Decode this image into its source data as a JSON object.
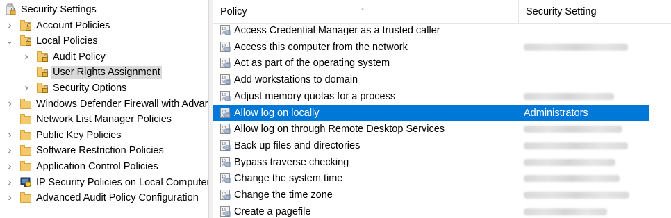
{
  "tree": {
    "items": [
      {
        "label": "Security Settings",
        "icon": "security-settings-icon",
        "expander": "",
        "indent": 0,
        "selected": false
      },
      {
        "label": "Account Policies",
        "icon": "locked-folder-icon",
        "expander": ">",
        "indent": 1,
        "selected": false
      },
      {
        "label": "Local Policies",
        "icon": "locked-folder-icon",
        "expander": "v",
        "indent": 1,
        "selected": false
      },
      {
        "label": "Audit Policy",
        "icon": "locked-folder-icon",
        "expander": ">",
        "indent": 2,
        "selected": false
      },
      {
        "label": "User Rights Assignment",
        "icon": "locked-folder-icon",
        "expander": "",
        "indent": 2,
        "selected": true
      },
      {
        "label": "Security Options",
        "icon": "locked-folder-icon",
        "expander": ">",
        "indent": 2,
        "selected": false
      },
      {
        "label": "Windows Defender Firewall with Advar",
        "icon": "folder-icon",
        "expander": ">",
        "indent": 1,
        "selected": false
      },
      {
        "label": "Network List Manager Policies",
        "icon": "folder-icon",
        "expander": "",
        "indent": 1,
        "selected": false
      },
      {
        "label": "Public Key Policies",
        "icon": "folder-icon",
        "expander": ">",
        "indent": 1,
        "selected": false
      },
      {
        "label": "Software Restriction Policies",
        "icon": "folder-icon",
        "expander": ">",
        "indent": 1,
        "selected": false
      },
      {
        "label": "Application Control Policies",
        "icon": "folder-icon",
        "expander": ">",
        "indent": 1,
        "selected": false
      },
      {
        "label": "IP Security Policies on Local Computer",
        "icon": "ip-security-icon",
        "expander": ">",
        "indent": 1,
        "selected": false
      },
      {
        "label": "Advanced Audit Policy Configuration",
        "icon": "folder-icon",
        "expander": ">",
        "indent": 1,
        "selected": false
      }
    ]
  },
  "list": {
    "columns": {
      "policy": "Policy",
      "setting": "Security Setting"
    },
    "rows": [
      {
        "policy": "Access Credential Manager as a trusted caller",
        "setting": "",
        "blurred": false,
        "selected": false
      },
      {
        "policy": "Access this computer from the network",
        "setting": "",
        "blurred": true,
        "selected": false
      },
      {
        "policy": "Act as part of the operating system",
        "setting": "",
        "blurred": false,
        "selected": false
      },
      {
        "policy": "Add workstations to domain",
        "setting": "",
        "blurred": false,
        "selected": false
      },
      {
        "policy": "Adjust memory quotas for a process",
        "setting": "",
        "blurred": true,
        "selected": false
      },
      {
        "policy": "Allow log on locally",
        "setting": "Administrators",
        "blurred": false,
        "selected": true
      },
      {
        "policy": "Allow log on through Remote Desktop Services",
        "setting": "",
        "blurred": true,
        "selected": false
      },
      {
        "policy": "Back up files and directories",
        "setting": "",
        "blurred": true,
        "selected": false
      },
      {
        "policy": "Bypass traverse checking",
        "setting": "",
        "blurred": true,
        "selected": false
      },
      {
        "policy": "Change the system time",
        "setting": "",
        "blurred": true,
        "selected": false
      },
      {
        "policy": "Change the time zone",
        "setting": "",
        "blurred": true,
        "selected": false
      },
      {
        "policy": "Create a pagefile",
        "setting": "",
        "blurred": true,
        "selected": false
      }
    ]
  },
  "colors": {
    "selection": "#0078d7",
    "tree_selection": "#d9d9d9"
  }
}
